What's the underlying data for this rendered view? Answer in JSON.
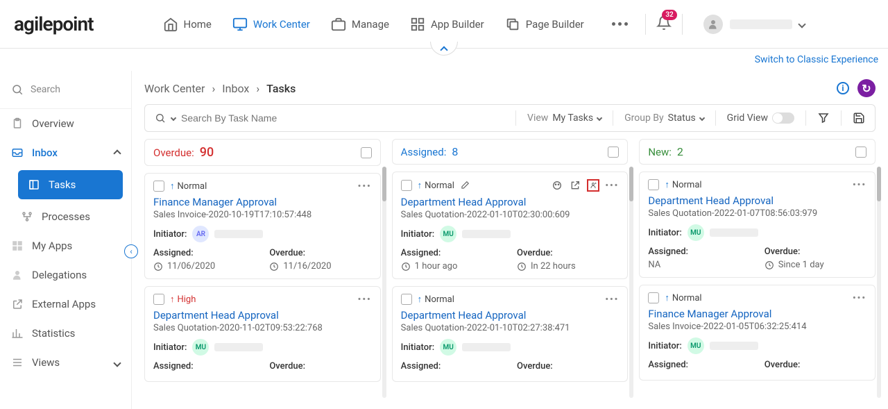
{
  "logo": "agilepoint",
  "nav": {
    "home": "Home",
    "work_center": "Work Center",
    "manage": "Manage",
    "app_builder": "App Builder",
    "page_builder": "Page Builder"
  },
  "notif_count": "32",
  "classic_link": "Switch to Classic Experience",
  "sidebar": {
    "search": "Search",
    "overview": "Overview",
    "inbox": "Inbox",
    "tasks": "Tasks",
    "processes": "Processes",
    "my_apps": "My Apps",
    "delegations": "Delegations",
    "external_apps": "External Apps",
    "statistics": "Statistics",
    "views": "Views"
  },
  "breadcrumb": {
    "work_center": "Work Center",
    "inbox": "Inbox",
    "tasks": "Tasks",
    "sep": "›"
  },
  "toolbar": {
    "search_placeholder": "Search By Task Name",
    "view_lbl": "View",
    "view_val": "My Tasks",
    "group_lbl": "Group By",
    "group_val": "Status",
    "grid_lbl": "Grid View"
  },
  "columns": [
    {
      "label": "Overdue:",
      "count": "90",
      "cls": "overdue"
    },
    {
      "label": "Assigned:",
      "count": "8",
      "cls": "assigned"
    },
    {
      "label": "New:",
      "count": "2",
      "cls": "new"
    }
  ],
  "labels": {
    "initiator": "Initiator:",
    "assigned": "Assigned:",
    "overdue": "Overdue:",
    "normal": "Normal",
    "high": "High"
  },
  "cards": {
    "c0": {
      "priority": "Normal",
      "pclass": "normal",
      "title": "Finance Manager Approval",
      "sub": "Sales Invoice-2020-10-19T17:10:57:448",
      "init": "AR",
      "iclass": "ar",
      "assigned": "11/06/2020",
      "overdue": "11/16/2020"
    },
    "c1": {
      "priority": "High",
      "pclass": "high",
      "title": "Department Head Approval",
      "sub": "Sales Quotation-2020-11-02T09:53:22:768",
      "init": "MU",
      "iclass": "mu",
      "assigned": "",
      "overdue": ""
    },
    "c2": {
      "priority": "Normal",
      "pclass": "normal",
      "title": "Department Head Approval",
      "sub": "Sales Quotation-2022-01-10T02:30:00:609",
      "init": "MU",
      "iclass": "mu",
      "assigned": "1 hour ago",
      "overdue": "In 22 hours"
    },
    "c3": {
      "priority": "Normal",
      "pclass": "normal",
      "title": "Department Head Approval",
      "sub": "Sales Quotation-2022-01-10T02:27:38:471",
      "init": "MU",
      "iclass": "mu",
      "assigned": "",
      "overdue": ""
    },
    "c4": {
      "priority": "Normal",
      "pclass": "normal",
      "title": "Department Head Approval",
      "sub": "Sales Quotation-2022-01-07T08:56:03:979",
      "init": "MU",
      "iclass": "mu",
      "assigned": "NA",
      "overdue": "Since 1 day",
      "no_assigned_icon": true
    },
    "c5": {
      "priority": "Normal",
      "pclass": "normal",
      "title": "Finance Manager Approval",
      "sub": "Sales Invoice-2022-01-05T06:32:25:414",
      "init": "MU",
      "iclass": "mu",
      "assigned": "",
      "overdue": ""
    }
  }
}
